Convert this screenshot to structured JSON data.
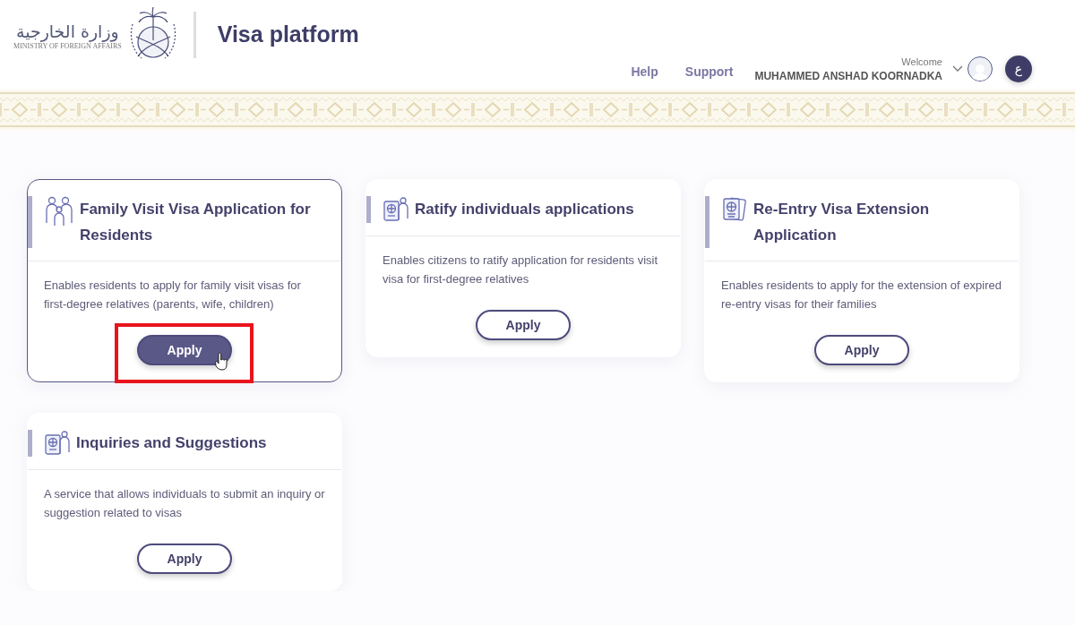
{
  "header": {
    "logo": {
      "arabic": "وزارة الخارجية",
      "english": "MINISTRY OF FOREIGN AFFAIRS"
    },
    "title": "Visa platform",
    "nav": [
      "Help",
      "Support"
    ],
    "user": {
      "greeting": "Welcome",
      "name": "MUHAMMED ANSHAD KOORNADKA"
    },
    "language_button": "ع"
  },
  "services": [
    {
      "kind": "family",
      "title": "Family Visit Visa Application for Residents",
      "description": "Enables residents to apply for family visit visas for first-degree relatives (parents, wife, children)",
      "button": "Apply",
      "hovered": true,
      "annotated": true
    },
    {
      "kind": "passport-person",
      "title": "Ratify individuals applications",
      "description": "Enables citizens to ratify application for residents visit visa for first-degree relatives",
      "button": "Apply",
      "hovered": false,
      "annotated": false
    },
    {
      "kind": "passports",
      "title": "Re-Entry Visa Extension Application",
      "description": "Enables residents to apply for the extension of expired re-entry visas for their families",
      "button": "Apply",
      "hovered": false,
      "annotated": false
    },
    {
      "kind": "passport-person",
      "title": "Inquiries and Suggestions",
      "description": "A service that allows individuals to submit an inquiry or suggestion related to visas",
      "button": "Apply",
      "hovered": false,
      "annotated": false
    }
  ]
}
